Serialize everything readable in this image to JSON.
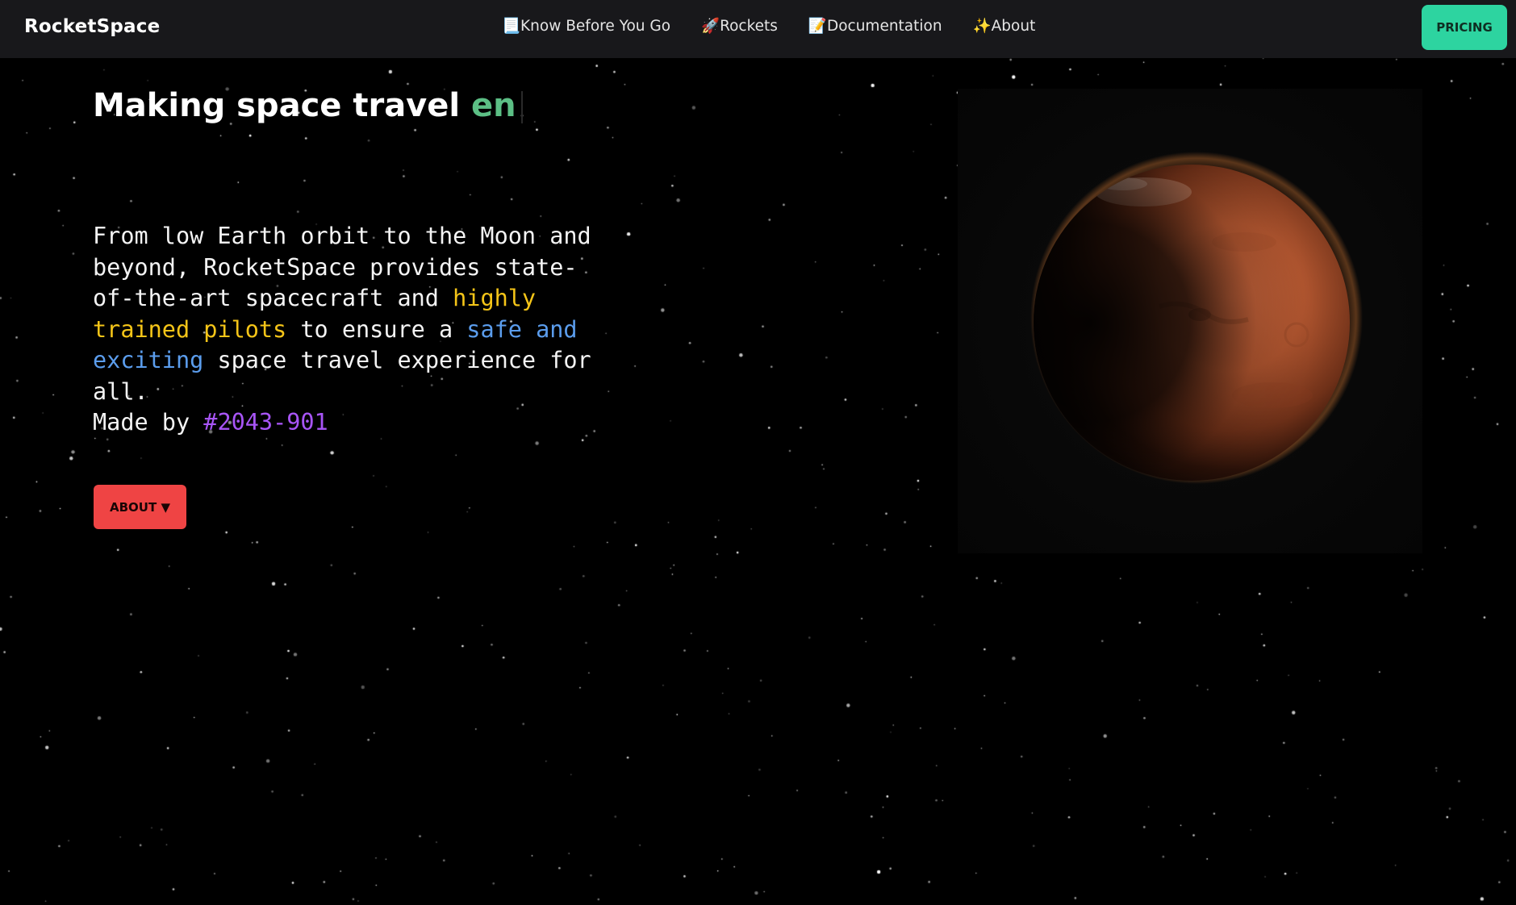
{
  "navbar": {
    "brand": "RocketSpace",
    "links": [
      {
        "icon": "📃",
        "label": "Know Before You Go"
      },
      {
        "icon": "🚀",
        "label": "Rockets"
      },
      {
        "icon": "📝",
        "label": "Documentation"
      },
      {
        "icon": "✨",
        "label": "About"
      }
    ],
    "pricing_label": "PRICING"
  },
  "hero": {
    "title_prefix": "Making space travel ",
    "title_typed": "en",
    "text": {
      "part1": "From low Earth orbit to the Moon and beyond, RocketSpace provides state-of-the-art spacecraft and ",
      "highlight1": "highly trained pilots",
      "part2": " to ensure a ",
      "highlight2": "safe and exciting",
      "part3": " space travel experience for all.",
      "made_by_label": "Made by ",
      "made_by_id": "#2043-901"
    },
    "about_button_label": "ABOUT ▼"
  },
  "colors": {
    "navbar_bg": "#18181b",
    "pricing_bg": "#2dd4a0",
    "about_bg": "#ef4444",
    "title_accent": "#5cbf85",
    "highlight_yellow": "#f5c518",
    "highlight_blue": "#5b9ded",
    "highlight_purple": "#a855f7"
  },
  "images": {
    "hero_planet": "mars-planet"
  }
}
